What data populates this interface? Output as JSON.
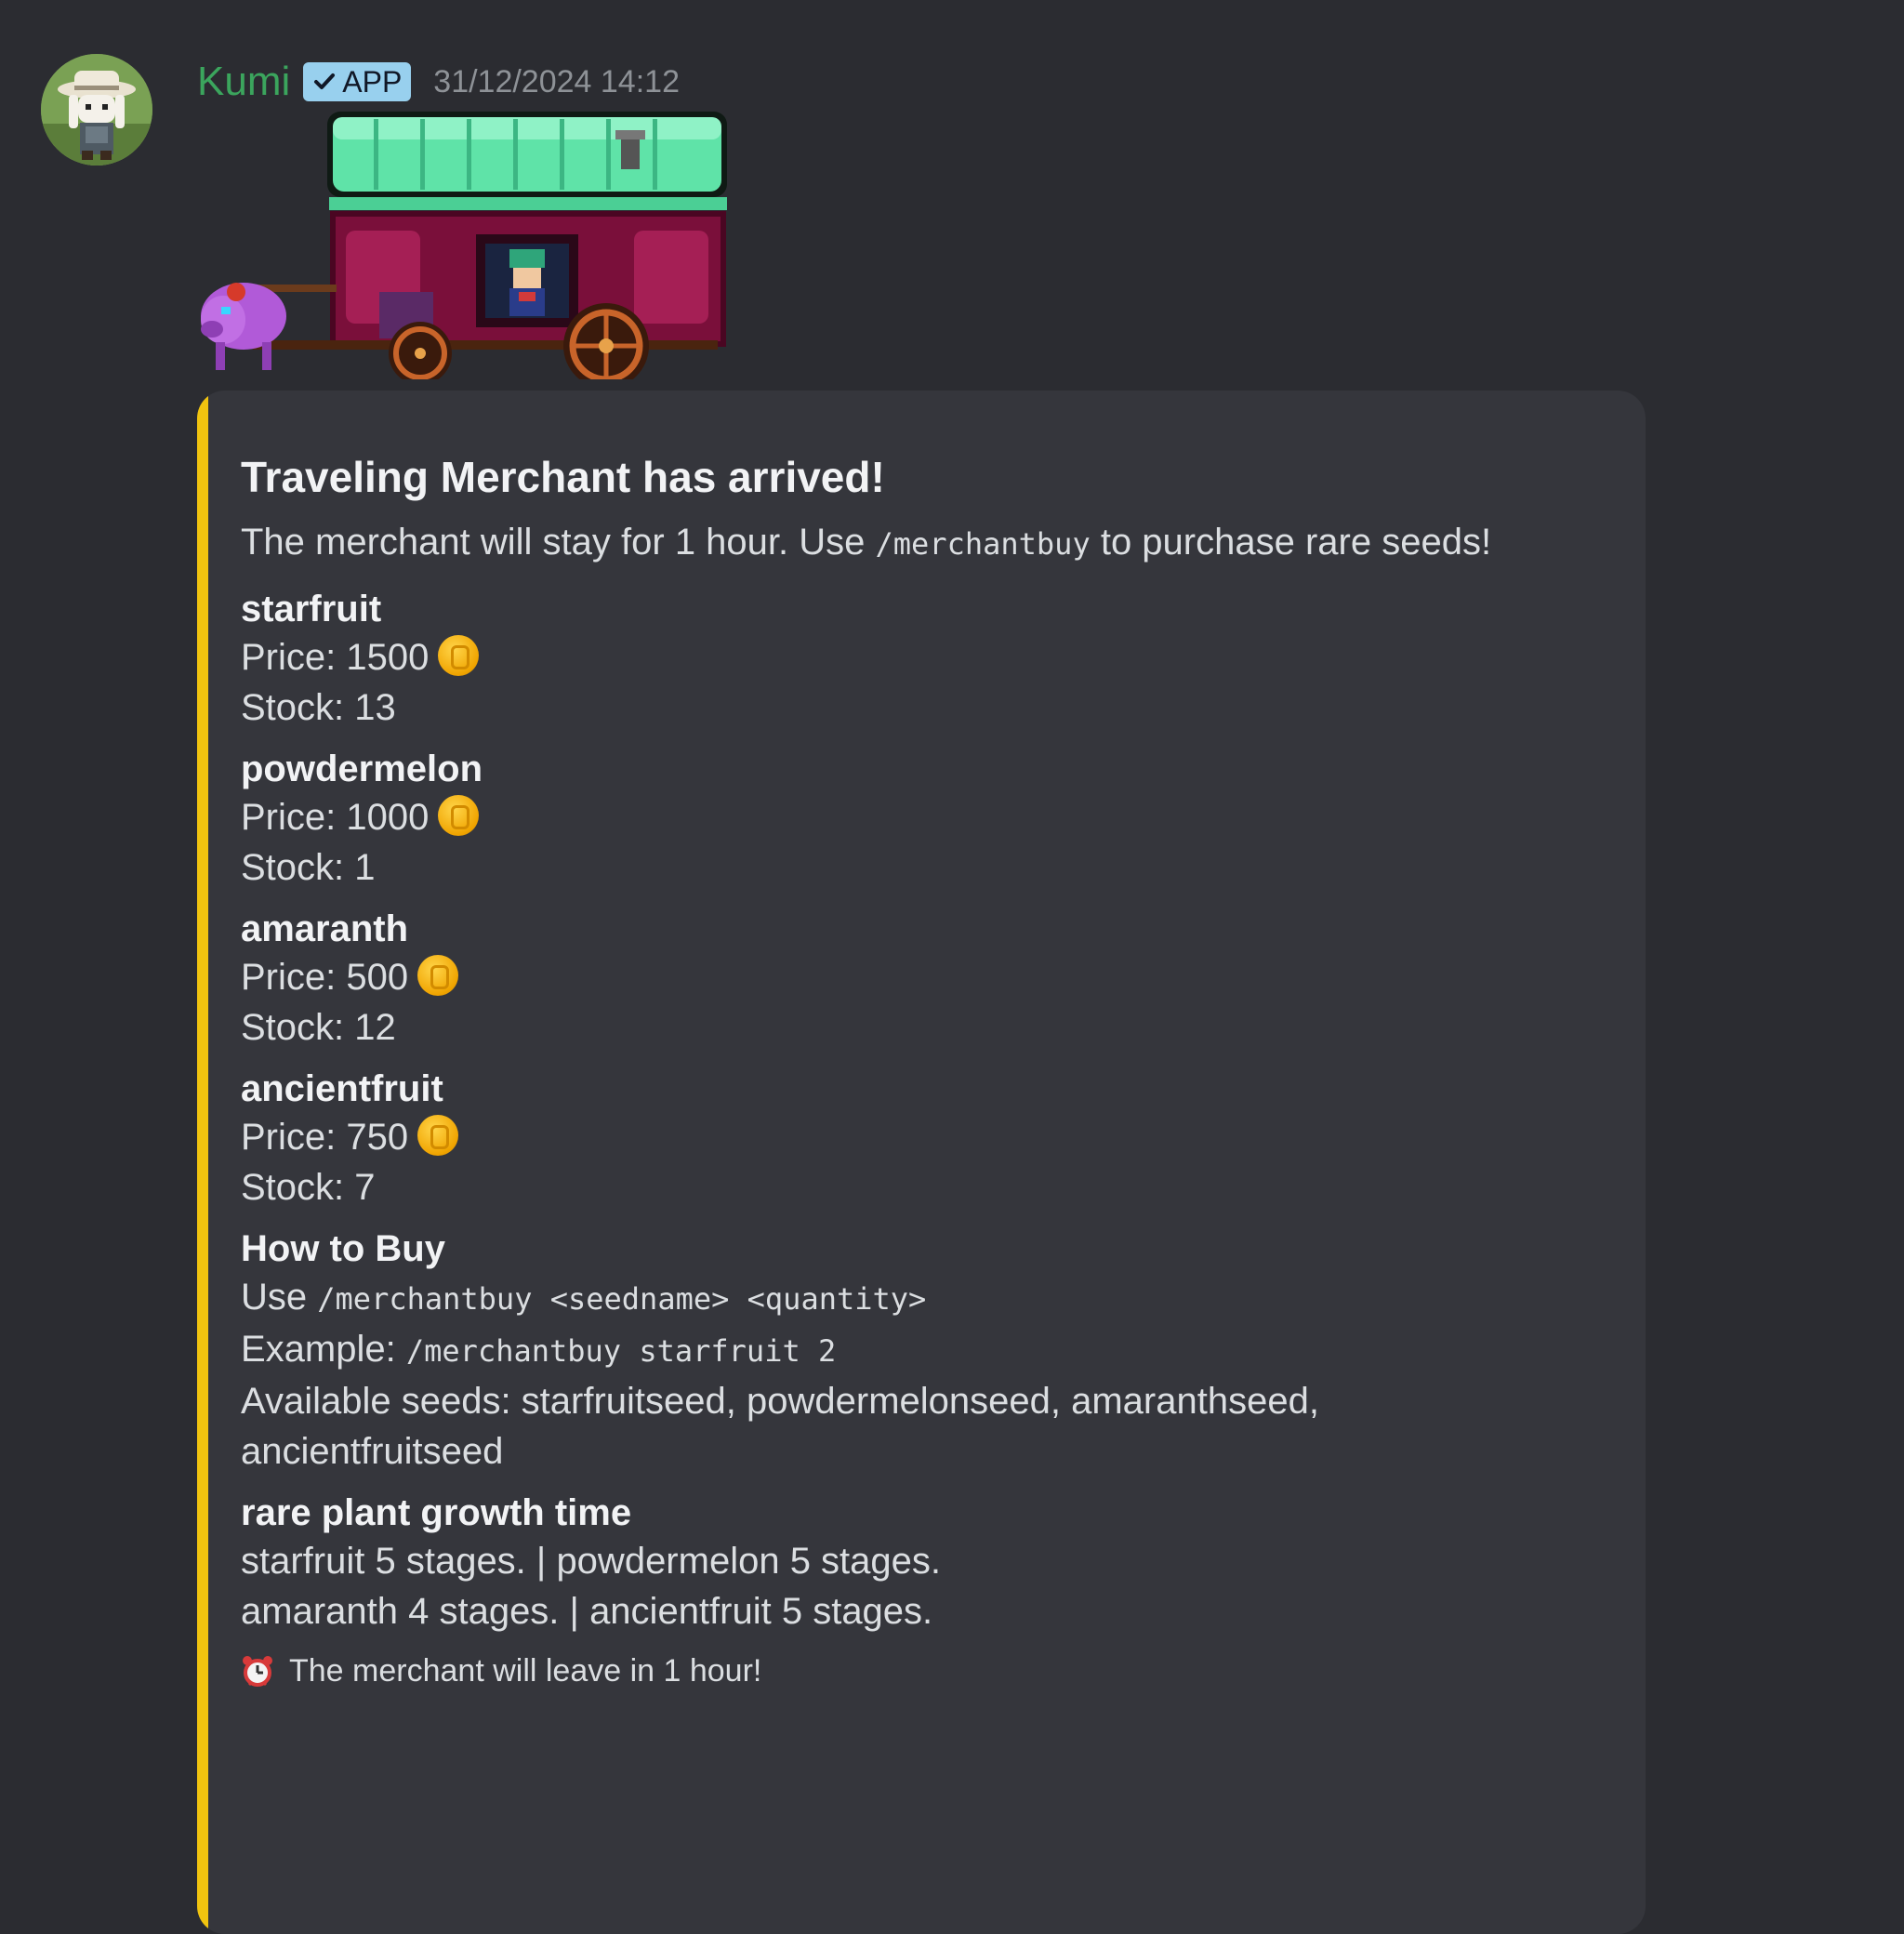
{
  "message": {
    "author": "Kumi",
    "badge": "APP",
    "timestamp": "31/12/2024 14:12"
  },
  "embed": {
    "accent_color": "#f1c40f",
    "title": "Traveling Merchant has arrived!",
    "description_before": "The merchant will stay for 1 hour. Use",
    "description_code": "/merchantbuy",
    "description_after": "to purchase rare seeds!",
    "items": [
      {
        "name": "starfruit",
        "price_text": "Price: 1500",
        "stock_text": "Stock: 13"
      },
      {
        "name": "powdermelon",
        "price_text": "Price: 1000",
        "stock_text": "Stock: 1"
      },
      {
        "name": "amaranth",
        "price_text": "Price: 500",
        "stock_text": "Stock: 12"
      },
      {
        "name": "ancientfruit",
        "price_text": "Price: 750",
        "stock_text": "Stock: 7"
      }
    ],
    "how_to_buy": {
      "name": "How to Buy",
      "use_label": "Use",
      "use_code": "/merchantbuy <seedname> <quantity>",
      "example_label": "Example:",
      "example_code": "/merchantbuy starfruit 2",
      "available": "Available seeds: starfruitseed, powdermelonseed, amaranthseed, ancientfruitseed"
    },
    "growth": {
      "name": "rare plant growth time",
      "line1_a": "starfruit 5 stages.",
      "line1_b": "powdermelon 5 stages.",
      "line2_a": "amaranth 4 stages.",
      "line2_b": "ancientfruit 5 stages.",
      "separator": "|"
    },
    "footer": "The merchant will leave in 1 hour!"
  },
  "icons": {
    "avatar": "bunny-farmer-avatar",
    "badge_check": "check-icon",
    "coin": "gold-coin-icon",
    "footer": "alarm-clock-icon",
    "thumbnail": "merchant-wagon-image"
  },
  "colors": {
    "background": "#2b2c31",
    "embed_bg": "#35363c",
    "username": "#3ba55d",
    "badge_bg": "#98d0ee"
  }
}
